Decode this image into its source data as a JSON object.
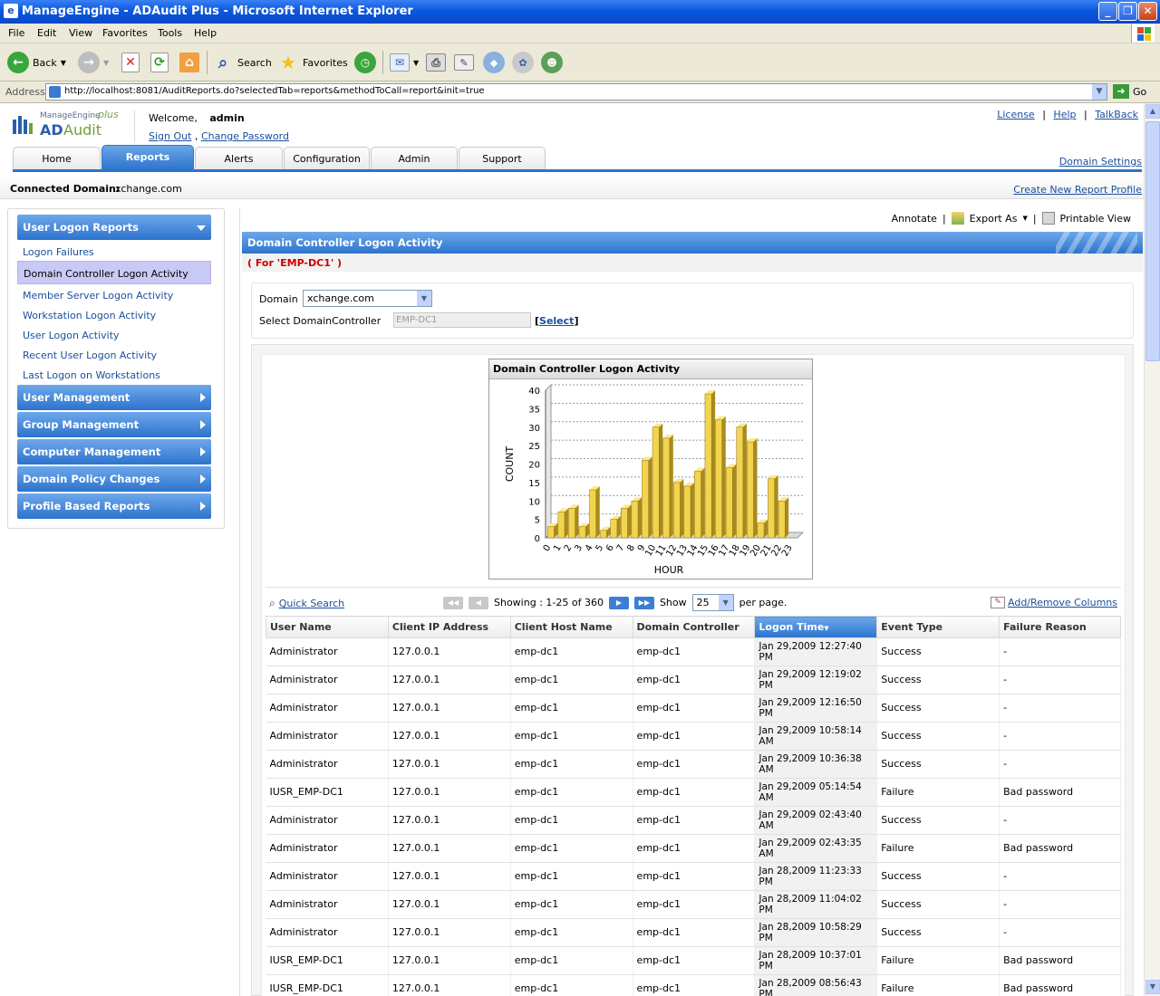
{
  "window": {
    "title": "ManageEngine - ADAudit Plus - Microsoft Internet Explorer",
    "icon": "ie-icon"
  },
  "menubar": [
    "File",
    "Edit",
    "View",
    "Favorites",
    "Tools",
    "Help"
  ],
  "toolbar": {
    "back": "Back",
    "search": "Search",
    "favorites": "Favorites"
  },
  "address": {
    "label": "Address",
    "url": "http://localhost:8081/AuditReports.do?selectedTab=reports&methodToCall=report&init=true",
    "go": "Go"
  },
  "app": {
    "logo_company": "ManageEngine",
    "logo_plus": "plus",
    "logo_ad": "AD",
    "logo_audit": "Audit",
    "welcome": "Welcome,",
    "user": "admin",
    "sign_out": "Sign Out",
    "change_password": "Change Password",
    "links": [
      "License",
      "Help",
      "TalkBack"
    ],
    "tabs": [
      "Home",
      "Reports",
      "Alerts",
      "Configuration",
      "Admin",
      "Support"
    ],
    "active_tab": "Reports",
    "domain_settings": "Domain Settings",
    "connected_label": "Connected Domain:",
    "connected_value": "xchange.com",
    "create_profile": "Create New Report Profile"
  },
  "sidebar": {
    "section": "User Logon Reports",
    "items": [
      "Logon Failures",
      "Domain Controller Logon Activity",
      "Member Server Logon Activity",
      "Workstation Logon Activity",
      "User Logon Activity",
      "Recent User Logon Activity",
      "Last Logon on Workstations"
    ],
    "active_item": "Domain Controller Logon Activity",
    "groups": [
      "User Management",
      "Group Management",
      "Computer Management",
      "Domain Policy Changes",
      "Profile Based Reports"
    ]
  },
  "report": {
    "actions": {
      "annotate": "Annotate",
      "export": "Export As",
      "print": "Printable View"
    },
    "title": "Domain Controller Logon Activity",
    "for_line": "( For 'EMP-DC1' )",
    "domain_label": "Domain",
    "domain_value": "xchange.com",
    "dc_label": "Select DomainController",
    "dc_value": "EMP-DC1",
    "select_open": "[",
    "select_link": "Select",
    "select_close": "]",
    "quick_search": "Quick Search",
    "showing": "Showing : 1-25 of 360",
    "show_label": "Show",
    "show_value": "25",
    "per_page": "per page.",
    "add_remove": "Add/Remove Columns"
  },
  "chart_data": {
    "type": "bar",
    "title": "Domain Controller Logon Activity",
    "xlabel": "HOUR",
    "ylabel": "COUNT",
    "categories": [
      "0",
      "1",
      "2",
      "3",
      "4",
      "5",
      "6",
      "7",
      "8",
      "9",
      "10",
      "11",
      "12",
      "13",
      "14",
      "15",
      "16",
      "17",
      "18",
      "19",
      "20",
      "21",
      "22",
      "23"
    ],
    "values": [
      3,
      7,
      8,
      3,
      13,
      2,
      5,
      8,
      10,
      21,
      30,
      27,
      15,
      14,
      18,
      39,
      32,
      19,
      30,
      26,
      4,
      16,
      10,
      0
    ],
    "ylim": [
      0,
      40
    ],
    "yticks": [
      0,
      5,
      10,
      15,
      20,
      25,
      30,
      35,
      40
    ],
    "grid": true,
    "bar_color": "#f2d44e"
  },
  "table": {
    "columns": [
      "User Name",
      "Client IP Address",
      "Client Host Name",
      "Domain Controller",
      "Logon Time",
      "Event Type",
      "Failure Reason"
    ],
    "sorted_column": "Logon Time",
    "rows": [
      [
        "Administrator",
        "127.0.0.1",
        "emp-dc1",
        "emp-dc1",
        "Jan 29,2009 12:27:40 PM",
        "Success",
        "-"
      ],
      [
        "Administrator",
        "127.0.0.1",
        "emp-dc1",
        "emp-dc1",
        "Jan 29,2009 12:19:02 PM",
        "Success",
        "-"
      ],
      [
        "Administrator",
        "127.0.0.1",
        "emp-dc1",
        "emp-dc1",
        "Jan 29,2009 12:16:50 PM",
        "Success",
        "-"
      ],
      [
        "Administrator",
        "127.0.0.1",
        "emp-dc1",
        "emp-dc1",
        "Jan 29,2009 10:58:14 AM",
        "Success",
        "-"
      ],
      [
        "Administrator",
        "127.0.0.1",
        "emp-dc1",
        "emp-dc1",
        "Jan 29,2009 10:36:38 AM",
        "Success",
        "-"
      ],
      [
        "IUSR_EMP-DC1",
        "127.0.0.1",
        "emp-dc1",
        "emp-dc1",
        "Jan 29,2009 05:14:54 AM",
        "Failure",
        "Bad password"
      ],
      [
        "Administrator",
        "127.0.0.1",
        "emp-dc1",
        "emp-dc1",
        "Jan 29,2009 02:43:40 AM",
        "Success",
        "-"
      ],
      [
        "Administrator",
        "127.0.0.1",
        "emp-dc1",
        "emp-dc1",
        "Jan 29,2009 02:43:35 AM",
        "Failure",
        "Bad password"
      ],
      [
        "Administrator",
        "127.0.0.1",
        "emp-dc1",
        "emp-dc1",
        "Jan 28,2009 11:23:33 PM",
        "Success",
        "-"
      ],
      [
        "Administrator",
        "127.0.0.1",
        "emp-dc1",
        "emp-dc1",
        "Jan 28,2009 11:04:02 PM",
        "Success",
        "-"
      ],
      [
        "Administrator",
        "127.0.0.1",
        "emp-dc1",
        "emp-dc1",
        "Jan 28,2009 10:58:29 PM",
        "Success",
        "-"
      ],
      [
        "IUSR_EMP-DC1",
        "127.0.0.1",
        "emp-dc1",
        "emp-dc1",
        "Jan 28,2009 10:37:01 PM",
        "Failure",
        "Bad password"
      ],
      [
        "IUSR_EMP-DC1",
        "127.0.0.1",
        "emp-dc1",
        "emp-dc1",
        "Jan 28,2009 08:56:43 PM",
        "Failure",
        "Bad password"
      ]
    ]
  }
}
